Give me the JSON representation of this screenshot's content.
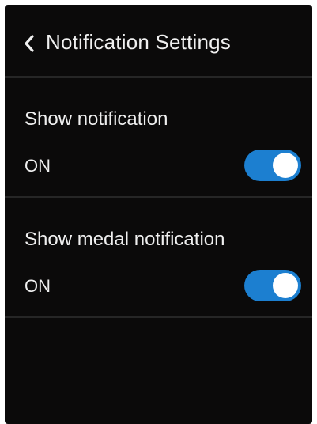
{
  "header": {
    "title": "Notification Settings",
    "back_icon": "chevron-left-icon"
  },
  "settings": [
    {
      "label": "Show notification",
      "status": "ON",
      "enabled": true
    },
    {
      "label": "Show medal notification",
      "status": "ON",
      "enabled": true
    }
  ],
  "colors": {
    "background": "#0b0a0a",
    "divider": "#262626",
    "text": "#eeeeee",
    "toggle_on": "#1c7fd0",
    "knob": "#ffffff"
  }
}
